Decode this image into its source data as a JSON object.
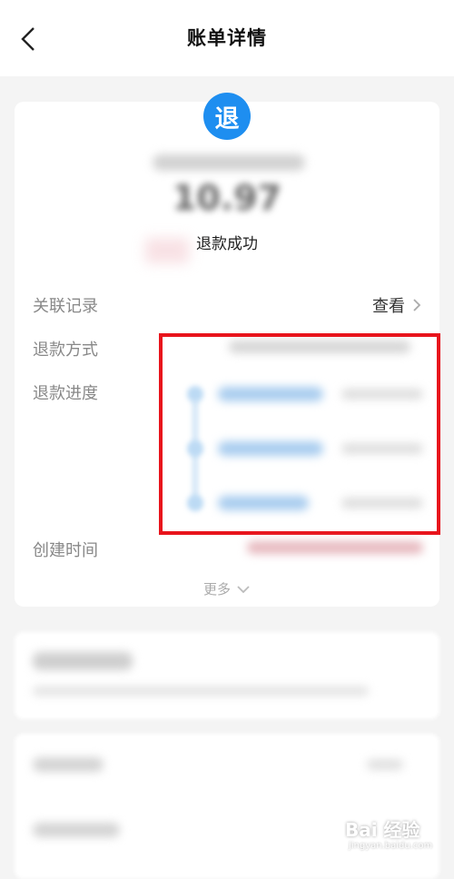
{
  "header": {
    "title": "账单详情",
    "back_icon": "chevron-left-icon"
  },
  "summary": {
    "badge_char": "退",
    "badge_color": "#1e8ef0",
    "amount": "10.97",
    "status": "退款成功"
  },
  "details": {
    "rows": [
      {
        "label": "关联记录",
        "value": "查看"
      },
      {
        "label": "退款方式"
      },
      {
        "label": "退款进度"
      },
      {
        "label": "创建时间"
      }
    ],
    "more_label": "更多"
  },
  "highlight_color": "#e8141c",
  "watermark": {
    "text": "Bai 经验",
    "subtext": "jingyan.baidu.com"
  }
}
